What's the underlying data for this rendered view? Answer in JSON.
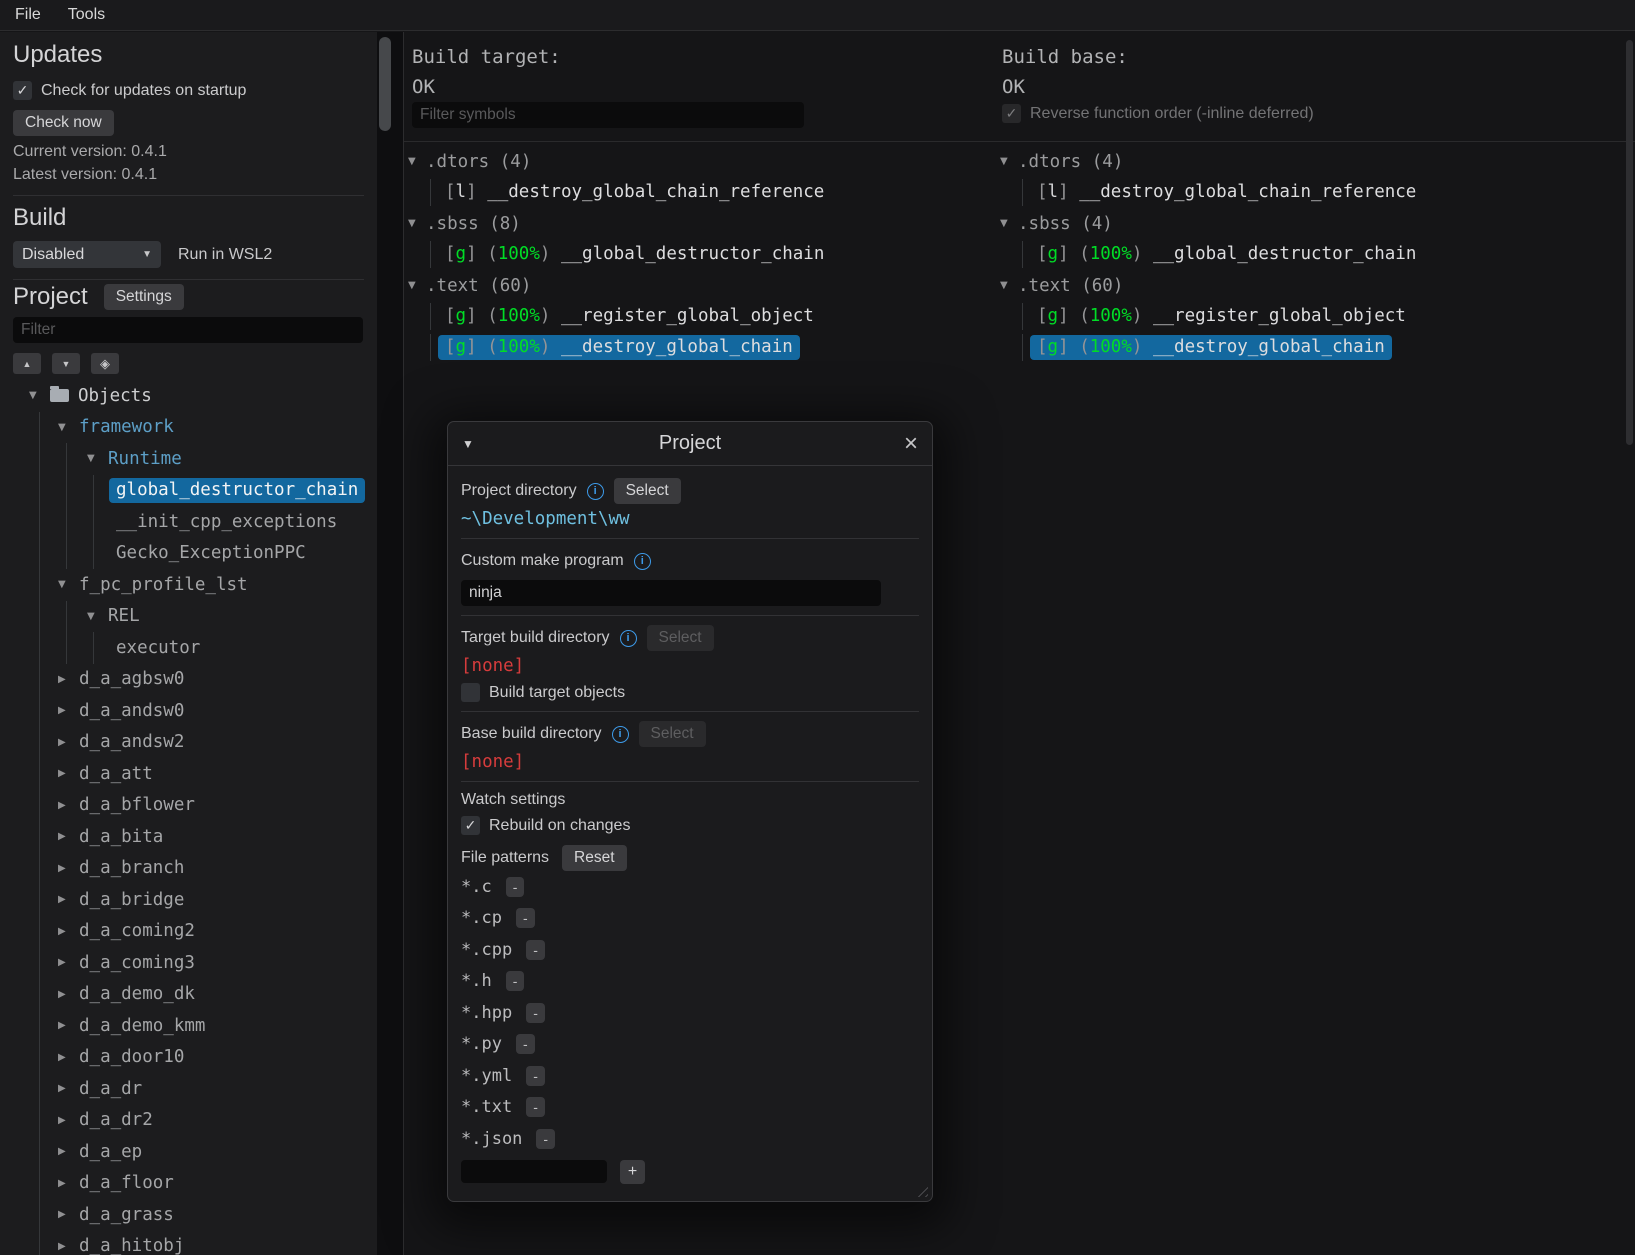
{
  "ui": {
    "checkmark": "✓",
    "arrow_open": "▼",
    "arrow_closed": "▶",
    "info_glyph": "i",
    "caret_down": "▼",
    "sort_up": "▲",
    "sort_down": "▼",
    "locate_glyph": "◈"
  },
  "colors": {
    "selection_blue": "#13689f",
    "match_green": "#00dd26",
    "missing_red": "#d63c3c",
    "unit_cyan": "#5d9fc7",
    "path_cyan": "#6fc0e0",
    "info_blue": "#3d9ae8"
  },
  "menu": {
    "file": "File",
    "tools": "Tools"
  },
  "sidebar": {
    "updates": {
      "heading": "Updates",
      "check_on_startup_label": "Check for updates on startup",
      "check_on_startup_checked": true,
      "check_now_button": "Check now",
      "current_version": "Current version: 0.4.1",
      "latest_version": "Latest version: 0.4.1"
    },
    "build": {
      "heading": "Build",
      "mode_dropdown_value": "Disabled",
      "wsl_label": "Run in WSL2"
    },
    "project": {
      "heading": "Project",
      "settings_button": "Settings",
      "filter_placeholder": "Filter",
      "tree": [
        {
          "label": "Objects",
          "depth": 0,
          "arrow": "open",
          "icon": "folder",
          "style": "bright"
        },
        {
          "label": "framework",
          "depth": 1,
          "arrow": "open",
          "style": "loaded"
        },
        {
          "label": "Runtime",
          "depth": 2,
          "arrow": "open",
          "style": "loaded"
        },
        {
          "label": "global_destructor_chain",
          "depth": 3,
          "style": "selected"
        },
        {
          "label": "__init_cpp_exceptions",
          "depth": 3,
          "style": "plain"
        },
        {
          "label": "Gecko_ExceptionPPC",
          "depth": 3,
          "style": "plain"
        },
        {
          "label": "f_pc_profile_lst",
          "depth": 1,
          "arrow": "open",
          "style": "plain"
        },
        {
          "label": "REL",
          "depth": 2,
          "arrow": "open",
          "style": "plain"
        },
        {
          "label": "executor",
          "depth": 3,
          "style": "plain"
        },
        {
          "label": "d_a_agbsw0",
          "depth": 1,
          "arrow": "closed",
          "style": "plain"
        },
        {
          "label": "d_a_andsw0",
          "depth": 1,
          "arrow": "closed",
          "style": "plain"
        },
        {
          "label": "d_a_andsw2",
          "depth": 1,
          "arrow": "closed",
          "style": "plain"
        },
        {
          "label": "d_a_att",
          "depth": 1,
          "arrow": "closed",
          "style": "plain"
        },
        {
          "label": "d_a_bflower",
          "depth": 1,
          "arrow": "closed",
          "style": "plain"
        },
        {
          "label": "d_a_bita",
          "depth": 1,
          "arrow": "closed",
          "style": "plain"
        },
        {
          "label": "d_a_branch",
          "depth": 1,
          "arrow": "closed",
          "style": "plain"
        },
        {
          "label": "d_a_bridge",
          "depth": 1,
          "arrow": "closed",
          "style": "plain"
        },
        {
          "label": "d_a_coming2",
          "depth": 1,
          "arrow": "closed",
          "style": "plain"
        },
        {
          "label": "d_a_coming3",
          "depth": 1,
          "arrow": "closed",
          "style": "plain"
        },
        {
          "label": "d_a_demo_dk",
          "depth": 1,
          "arrow": "closed",
          "style": "plain"
        },
        {
          "label": "d_a_demo_kmm",
          "depth": 1,
          "arrow": "closed",
          "style": "plain"
        },
        {
          "label": "d_a_door10",
          "depth": 1,
          "arrow": "closed",
          "style": "plain"
        },
        {
          "label": "d_a_dr",
          "depth": 1,
          "arrow": "closed",
          "style": "plain"
        },
        {
          "label": "d_a_dr2",
          "depth": 1,
          "arrow": "closed",
          "style": "plain"
        },
        {
          "label": "d_a_ep",
          "depth": 1,
          "arrow": "closed",
          "style": "plain"
        },
        {
          "label": "d_a_floor",
          "depth": 1,
          "arrow": "closed",
          "style": "plain"
        },
        {
          "label": "d_a_grass",
          "depth": 1,
          "arrow": "closed",
          "style": "plain"
        },
        {
          "label": "d_a_hitobj",
          "depth": 1,
          "arrow": "closed",
          "style": "plain"
        }
      ]
    }
  },
  "target_panel": {
    "title": "Build target:",
    "status": "OK",
    "filter_placeholder": "Filter symbols",
    "sections": [
      {
        "header": ".dtors (4)",
        "symbols": [
          {
            "flag": "l",
            "name": "__destroy_global_chain_reference"
          }
        ]
      },
      {
        "header": ".sbss (8)",
        "symbols": [
          {
            "flag": "g",
            "match": "100%",
            "name": "__global_destructor_chain"
          }
        ]
      },
      {
        "header": ".text (60)",
        "symbols": [
          {
            "flag": "g",
            "match": "100%",
            "name": "__register_global_object"
          },
          {
            "flag": "g",
            "match": "100%",
            "name": "__destroy_global_chain",
            "selected": true
          }
        ]
      }
    ]
  },
  "base_panel": {
    "title": "Build base:",
    "status": "OK",
    "reverse_checkbox_label": "Reverse function order (-inline deferred)",
    "reverse_checkbox_checked": true,
    "sections": [
      {
        "header": ".dtors (4)",
        "symbols": [
          {
            "flag": "l",
            "name": "__destroy_global_chain_reference"
          }
        ]
      },
      {
        "header": ".sbss (4)",
        "symbols": [
          {
            "flag": "g",
            "match": "100%",
            "name": "__global_destructor_chain"
          }
        ]
      },
      {
        "header": ".text (60)",
        "symbols": [
          {
            "flag": "g",
            "match": "100%",
            "name": "__register_global_object"
          },
          {
            "flag": "g",
            "match": "100%",
            "name": "__destroy_global_chain",
            "selected": true
          }
        ]
      }
    ]
  },
  "dialog": {
    "title": "Project",
    "collapse_button": "▼",
    "close_button": "×",
    "project_directory": {
      "label": "Project directory",
      "select_button": "Select",
      "value": "~\\Development\\ww"
    },
    "custom_make_program": {
      "label": "Custom make program",
      "value": "ninja"
    },
    "target_build_directory": {
      "label": "Target build directory",
      "select_button": "Select",
      "value": "[none]",
      "checkbox_label": "Build target objects",
      "checkbox_checked": false
    },
    "base_build_directory": {
      "label": "Base build directory",
      "select_button": "Select",
      "value": "[none]"
    },
    "watch_settings": {
      "heading": "Watch settings",
      "rebuild_label": "Rebuild on changes",
      "rebuild_checked": true,
      "file_patterns_label": "File patterns",
      "reset_button": "Reset",
      "patterns": [
        "*.c",
        "*.cp",
        "*.cpp",
        "*.h",
        "*.hpp",
        "*.py",
        "*.yml",
        "*.txt",
        "*.json"
      ],
      "remove_button": "-",
      "add_button": "+",
      "new_pattern_value": ""
    }
  }
}
